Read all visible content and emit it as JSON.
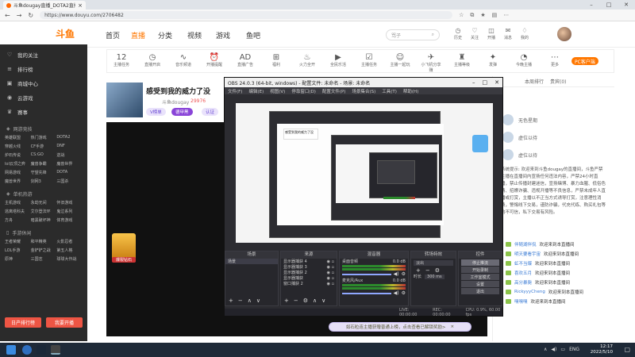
{
  "browser": {
    "tab_title": "斗鱼dougay直播_DOTA2直播_...",
    "url": "https://www.douyu.com/2706482"
  },
  "header": {
    "logo": "斗鱼",
    "nav": [
      "首页",
      "直播",
      "分类",
      "视频",
      "游戏",
      "鱼吧"
    ],
    "search_placeholder": "骂子",
    "icons": [
      {
        "icon": "history-icon",
        "label": "历史"
      },
      {
        "icon": "follow-icon",
        "label": "关注"
      },
      {
        "icon": "broadcast-icon",
        "label": "开播"
      },
      {
        "icon": "message-icon",
        "label": "消息"
      },
      {
        "icon": "bell-icon",
        "label": "我的"
      }
    ]
  },
  "sidebar": {
    "items": [
      {
        "icon": "follow-icon",
        "label": "我的关注"
      },
      {
        "icon": "list-icon",
        "label": "排行榜"
      },
      {
        "icon": "center-icon",
        "label": "商城中心"
      },
      {
        "icon": "game-icon",
        "label": "云游戏"
      },
      {
        "icon": "trophy-icon",
        "label": "赛事"
      }
    ],
    "section1_title": "网游竞技",
    "section1_games": [
      "英雄联盟",
      "热门游戏",
      "DOTA2",
      "穿越火线",
      "CF手游",
      "DNF",
      "炉石传说",
      "CS:GO",
      "逆战",
      "lol云顶之弈",
      "魔兽争霸",
      "魔兽世界",
      "网易游戏",
      "守望先锋",
      "DOTA",
      "魔兽世界",
      "剑网3",
      "三国杀"
    ],
    "section2_title": "单机热游",
    "section2_games": [
      "主机游戏",
      "永劫无间",
      "怀旧游戏",
      "逃离塔科夫",
      "艾尔登法环",
      "鬼泣系列",
      "方舟",
      "暗黑破坏神",
      "体育游戏"
    ],
    "section3_title": "手游休闲",
    "section3_games": [
      "王者荣耀",
      "和平精英",
      "火影忍者",
      "LOL手游",
      "金铲铲之战",
      "第五人格",
      "原神",
      "三国志",
      "球球大作战"
    ],
    "btn_rank": "日产排行榜",
    "btn_live": "我要开播"
  },
  "room": {
    "toolbar": [
      {
        "icon": "count-icon",
        "label": "主播任务",
        "value": "12"
      },
      {
        "icon": "calendar-icon",
        "label": "直播开启"
      },
      {
        "icon": "wave-icon",
        "label": "音乐频道"
      },
      {
        "icon": "clock-icon",
        "label": "开播提醒"
      },
      {
        "icon": "ad-icon",
        "label": "直播广告"
      },
      {
        "icon": "gift-icon",
        "label": "福利"
      },
      {
        "icon": "fire-icon",
        "label": "火力全开"
      },
      {
        "icon": "play-icon",
        "label": "全民乐活"
      },
      {
        "icon": "task-icon",
        "label": "主播任务"
      },
      {
        "icon": "friend-icon",
        "label": "主播一起玩"
      },
      {
        "icon": "car-icon",
        "label": "小飞机分享赚"
      },
      {
        "icon": "rank-icon",
        "label": "主播等级"
      },
      {
        "icon": "gun-icon",
        "label": "发弹"
      },
      {
        "icon": "speed-icon",
        "label": "今晚主播"
      },
      {
        "icon": "more-icon",
        "label": "更多"
      }
    ],
    "pc_button": "PC客户端",
    "title": "感受到我的威力了没",
    "streamer": "斗鱼dougay",
    "heat": "29976",
    "tags": [
      "V榜单",
      "德甲黑",
      "认证"
    ],
    "chat_tabs": [
      "本周排行",
      "贵宾(0)"
    ],
    "fans": [
      {
        "name": "无色星期"
      },
      {
        "name": "虚位以待"
      },
      {
        "name": "虚位以待"
      }
    ],
    "notice": "系统提示: 欢迎来到斗鱼dougay的直播间，斗鱼严禁主播在直播间内宣扬任何违法内容，严禁24小时直播，禁止传播封建迷信，宣扬赌博、暴力血腥、低俗色情、招嫖诈骗、违规开播等不良信息，严禁未成年人直播或打赏，主播以不正当方式诱导打赏，注意理性消费，警惕线下交易，谨防诈骗，代充代练、购买礼包等均不可信，私下交易有风险。",
    "chat": [
      {
        "name": "伴随湖伴侃",
        "msg": "欢迎来到本直播间"
      },
      {
        "name": "明天要看宇宙",
        "msg": "欢迎来到本直播间"
      },
      {
        "name": "虹不当爆",
        "msg": "欢迎来到本直播间"
      },
      {
        "name": "喜欢五月",
        "msg": "欢迎来到本直播间"
      },
      {
        "name": "高分暴毙",
        "msg": "欢迎来到本直播间"
      },
      {
        "name": "RickyyyCheng",
        "msg": "欢迎来到本直播间"
      },
      {
        "name": "嘿嘿嘿",
        "msg": "欢迎来到本直播间"
      }
    ],
    "gift_label": "爆裂钻石"
  },
  "obs": {
    "title": "OBS 24.0.3 (64-bit, windows) - 配置文件: 未命名 - 场景: 未命名",
    "menu": [
      "文件(F)",
      "编辑(E)",
      "视图(V)",
      "停靠窗口(D)",
      "配置文件(P)",
      "场景集合(S)",
      "工具(T)",
      "帮助(H)"
    ],
    "docks": {
      "scenes": "场景",
      "sources": "来源",
      "mixer": "混音器",
      "transitions": "转场特效",
      "controls": "控件"
    },
    "scene_items": [
      "场景"
    ],
    "source_items": [
      "显示器捕获 4",
      "显示器捕获 3",
      "显示器捕获 2",
      "显示器捕获",
      "窗口捕获 2"
    ],
    "mixer_items": [
      "桌面音频",
      "麦克风/Aux"
    ],
    "mixer_db": [
      "0.0 dB",
      "0.0 dB"
    ],
    "transition": "淡出",
    "duration_label": "时长",
    "duration_value": "300 ms",
    "controls": [
      "停止推流",
      "开始录制",
      "工作室模式",
      "设置",
      "退出"
    ],
    "status": [
      "LIVE: 00:00:00",
      "REC: 00:00:00",
      "CPU: 0.9%, 60.00 fps"
    ]
  },
  "toast": {
    "text": "如石粒连主播获赠普通上榜，点击查看已解锁奖励>",
    "close": "×"
  },
  "taskbar": {
    "lang": "ENG",
    "time": "12:17",
    "date": "2022/5/10"
  },
  "colors": {
    "brand": "#ff7700",
    "sidebar_bg": "#2b2b2b",
    "obs_bg": "#2c2c31",
    "taskbar_bg": "#1f2a38"
  }
}
